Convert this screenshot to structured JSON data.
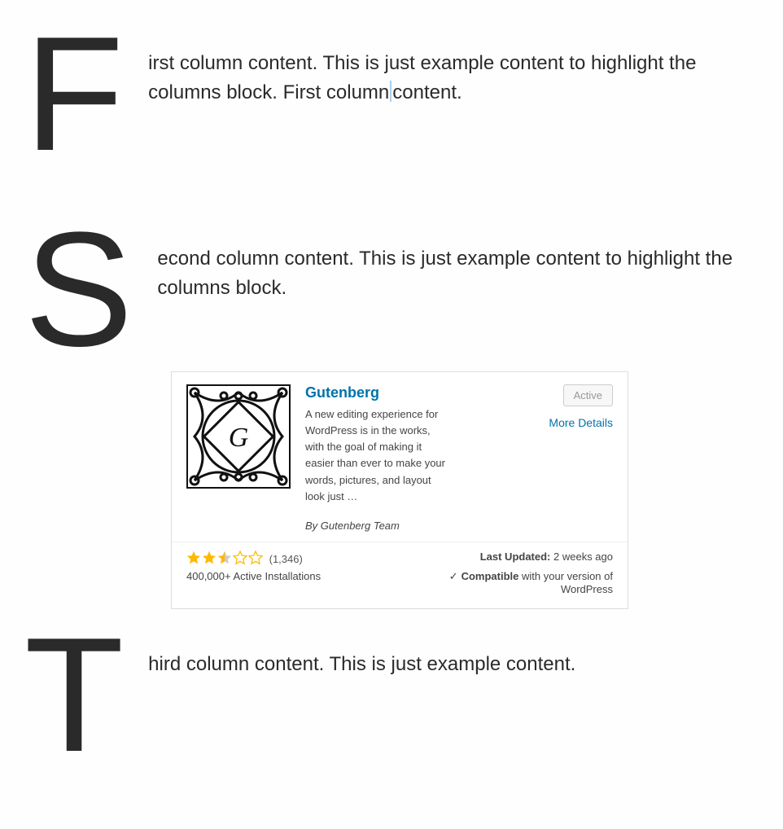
{
  "paragraph1": "irst column content. This is just example content to highlight the columns block. First column",
  "paragraph1b": "content.",
  "dropcap1": "F",
  "paragraph2": "econd column content. This is just example content to highlight the columns block.",
  "dropcap2": "S",
  "paragraph3": "hird column content. This is just example content.",
  "dropcap3": "T",
  "plugin": {
    "name": "Gutenberg",
    "description": "A new editing experience for WordPress is in the works, with the goal of making it easier than ever to make your words, pictures, and layout look just …",
    "author": "By Gutenberg Team",
    "active_label": "Active",
    "more_details": "More Details",
    "rating_stars": 2.5,
    "rating_count": "(1,346)",
    "installs": "400,000+ Active Installations",
    "last_updated_label": "Last Updated:",
    "last_updated_value": " 2 weeks ago",
    "compatible_label": "Compatible",
    "compatible_rest": " with your version of WordPress",
    "check_glyph": "✓"
  },
  "colors": {
    "link": "#0073aa",
    "star": "#ffb900",
    "star_empty": "#cccccc"
  }
}
